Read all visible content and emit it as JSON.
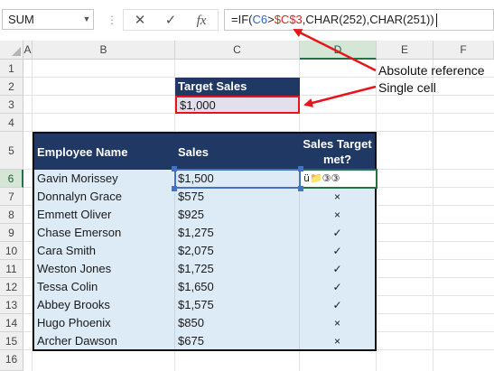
{
  "namebox": {
    "value": "SUM"
  },
  "formula_buttons": {
    "cancel": "✕",
    "enter": "✓",
    "fx": "fx"
  },
  "formula": {
    "prefix": "=IF(",
    "ref1": "C6",
    "op": ">",
    "ref2": "$C$3",
    "rest": ",CHAR(252),CHAR(251))"
  },
  "columns": [
    "A",
    "B",
    "C",
    "D",
    "E",
    "F"
  ],
  "rows": [
    "1",
    "2",
    "3",
    "4",
    "5",
    "6",
    "7",
    "8",
    "9",
    "10",
    "11",
    "12",
    "13",
    "14",
    "15",
    "16"
  ],
  "target": {
    "label": "Target Sales",
    "value": "$1,000"
  },
  "table": {
    "headers": {
      "name": "Employee Name",
      "sales": "Sales",
      "met_line1": "Sales Target",
      "met_line2": "met?"
    },
    "editing_cell_text": "ü᠎📁③③",
    "rows": [
      {
        "name": "Gavin Morissey",
        "sales": "$1,500",
        "met": ""
      },
      {
        "name": "Donnalyn Grace",
        "sales": "$575",
        "met": "×"
      },
      {
        "name": "Emmett Oliver",
        "sales": "$925",
        "met": "×"
      },
      {
        "name": "Chase Emerson",
        "sales": "$1,275",
        "met": "✓"
      },
      {
        "name": "Cara Smith",
        "sales": "$2,075",
        "met": "✓"
      },
      {
        "name": "Weston Jones",
        "sales": "$1,725",
        "met": "✓"
      },
      {
        "name": "Tessa Colin",
        "sales": "$1,650",
        "met": "✓"
      },
      {
        "name": "Abbey Brooks",
        "sales": "$1,575",
        "met": "✓"
      },
      {
        "name": "Hugo Phoenix",
        "sales": "$850",
        "met": "×"
      },
      {
        "name": "Archer Dawson",
        "sales": "$675",
        "met": "×"
      }
    ]
  },
  "annotations": {
    "absolute": "Absolute reference",
    "single": "Single cell"
  },
  "colors": {
    "header_fill": "#1f3864",
    "band_fill": "#ddebf7",
    "target_fill": "#e4dfec",
    "arrow": "#e8141c",
    "excel_green": "#217346"
  }
}
